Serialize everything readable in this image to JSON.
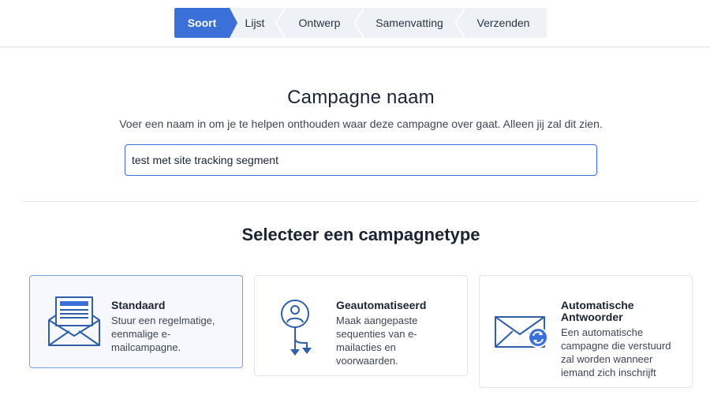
{
  "steps": [
    {
      "label": "Soort",
      "active": true
    },
    {
      "label": "Lijst",
      "active": false
    },
    {
      "label": "Ontwerp",
      "active": false
    },
    {
      "label": "Samenvatting",
      "active": false
    },
    {
      "label": "Verzenden",
      "active": false
    }
  ],
  "name_section": {
    "title": "Campagne naam",
    "subtitle": "Voer een naam in om je te helpen onthouden waar deze campagne over gaat. Alleen jij zal dit zien.",
    "input_value": "test met site tracking segment"
  },
  "type_section": {
    "title": "Selecteer een campagnetype",
    "cards": [
      {
        "title": "Standaard",
        "description": "Stuur een regelmatige, eenmalige e-mailcampagne.",
        "icon": "envelope-letter-icon",
        "selected": true
      },
      {
        "title": "Geautomatiseerd",
        "description": "Maak aangepaste sequenties van e-mailacties en voorwaarden.",
        "icon": "automation-person-icon",
        "selected": false
      },
      {
        "title": "Automatische Antwoorder",
        "description": "Een automatische campagne die verstuurd zal worden wanneer iemand zich inschrijft",
        "icon": "envelope-refresh-icon",
        "selected": false
      }
    ]
  },
  "colors": {
    "accent": "#3b70d8",
    "icon": "#2f5fa8"
  }
}
